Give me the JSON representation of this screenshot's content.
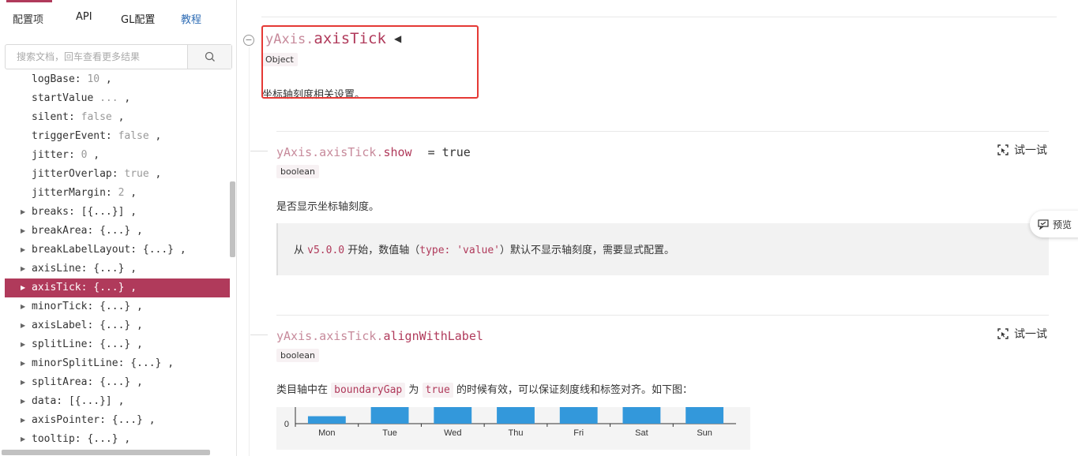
{
  "sidebar": {
    "tabs": [
      {
        "label": "配置项"
      },
      {
        "label": "API"
      },
      {
        "label": "GL配置"
      },
      {
        "label": "教程"
      }
    ],
    "search": {
      "placeholder": "搜索文档，回车查看更多结果"
    },
    "tree": [
      {
        "key": "logBase:",
        "value": "10",
        "suffix": " ,",
        "expandable": false
      },
      {
        "key": "startValue",
        "value": "...",
        "suffix": " ,",
        "expandable": false
      },
      {
        "key": "silent:",
        "value": "false",
        "suffix": " ,",
        "expandable": false
      },
      {
        "key": "triggerEvent:",
        "value": "false",
        "suffix": " ,",
        "expandable": false
      },
      {
        "key": "jitter:",
        "value": "0",
        "suffix": " ,",
        "expandable": false
      },
      {
        "key": "jitterOverlap:",
        "value": "true",
        "suffix": " ,",
        "expandable": false
      },
      {
        "key": "jitterMargin:",
        "value": "2",
        "suffix": " ,",
        "expandable": false
      },
      {
        "key": "breaks: [{...}]",
        "value": "",
        "suffix": " ,",
        "expandable": true
      },
      {
        "key": "breakArea: {...}",
        "value": "",
        "suffix": " ,",
        "expandable": true
      },
      {
        "key": "breakLabelLayout: {...}",
        "value": "",
        "suffix": " ,",
        "expandable": true
      },
      {
        "key": "axisLine: {...}",
        "value": "",
        "suffix": " ,",
        "expandable": true
      },
      {
        "key": "axisTick: {...}",
        "value": "",
        "suffix": " ,",
        "expandable": true,
        "active": true
      },
      {
        "key": "minorTick: {...}",
        "value": "",
        "suffix": " ,",
        "expandable": true
      },
      {
        "key": "axisLabel: {...}",
        "value": "",
        "suffix": " ,",
        "expandable": true
      },
      {
        "key": "splitLine: {...}",
        "value": "",
        "suffix": " ,",
        "expandable": true
      },
      {
        "key": "minorSplitLine: {...}",
        "value": "",
        "suffix": " ,",
        "expandable": true
      },
      {
        "key": "splitArea: {...}",
        "value": "",
        "suffix": " ,",
        "expandable": true
      },
      {
        "key": "data: [{...}]",
        "value": "",
        "suffix": " ,",
        "expandable": true
      },
      {
        "key": "axisPointer: {...}",
        "value": "",
        "suffix": " ,",
        "expandable": true
      },
      {
        "key": "tooltip: {...}",
        "value": "",
        "suffix": " ,",
        "expandable": true
      }
    ]
  },
  "main": {
    "collapse_symbol": "−",
    "title_prefix": "yAxis.",
    "title_name": "axisTick",
    "title_caret": "◀",
    "title_type": "Object",
    "description": "坐标轴刻度相关设置。",
    "sections": [
      {
        "prefix": "yAxis.axisTick.",
        "name": "show",
        "default": "= true",
        "type": "boolean",
        "try_label": "试一试",
        "description": "是否显示坐标轴刻度。",
        "note": {
          "t1": "从 ",
          "c1": "v5.0.0",
          "t2": " 开始，数值轴（",
          "c2": "type: 'value'",
          "t3": "）默认不显示轴刻度，需要显式配置。"
        }
      },
      {
        "prefix": "yAxis.axisTick.",
        "name": "alignWithLabel",
        "type": "boolean",
        "try_label": "试一试",
        "description": {
          "t1": "类目轴中在 ",
          "c1": "boundaryGap",
          "t2": " 为 ",
          "c2": "true",
          "t3": " 的时候有效，可以保证刻度线和标签对齐。如下图："
        }
      }
    ],
    "preview_label": "预览"
  },
  "chart_data": {
    "type": "bar",
    "categories": [
      "Mon",
      "Tue",
      "Wed",
      "Thu",
      "Fri",
      "Sat",
      "Sun"
    ],
    "y_tick_labels": [
      "0"
    ],
    "bar_color": "#3398db",
    "values": [
      0.45,
      1,
      1,
      1,
      1,
      1,
      1
    ],
    "title": "",
    "xlabel": "",
    "ylabel": ""
  },
  "colors": {
    "accent": "#b03a5b",
    "link": "#2f6db5",
    "highlight_box": "#e53935"
  }
}
